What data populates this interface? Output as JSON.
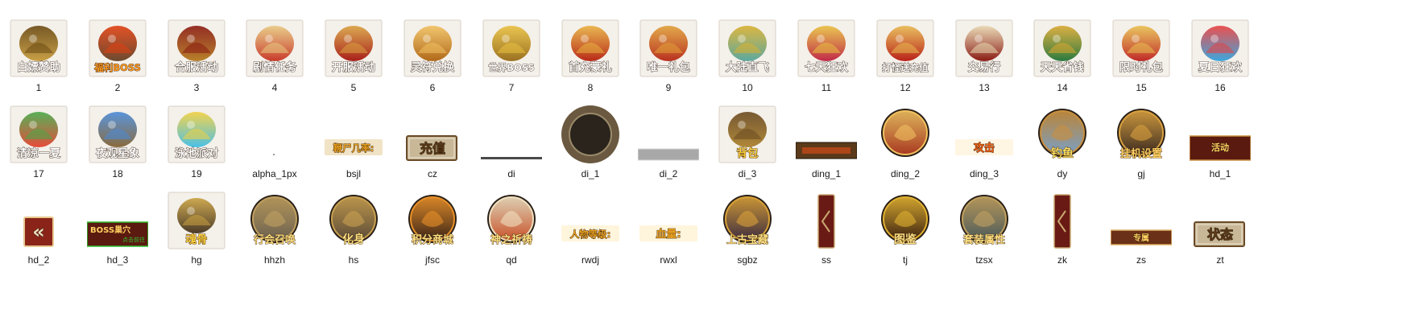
{
  "window": {
    "view": "large-icons"
  },
  "items": [
    {
      "name": "1",
      "caption": "白嫖赞助",
      "icon": "dragon-orb-icon",
      "style": "square",
      "color": "#c9a046",
      "accent": "#6b4a12"
    },
    {
      "name": "2",
      "caption": "福利BOSS",
      "icon": "winged-demon-icon",
      "style": "square",
      "color": "#6b4a30",
      "accent": "#e04010",
      "caption_color": "#ff9a20"
    },
    {
      "name": "3",
      "caption": "合服活动",
      "icon": "golden-dragon-chest-icon",
      "style": "square",
      "color": "#b8822a",
      "accent": "#8a1a10"
    },
    {
      "name": "4",
      "caption": "剧情任务",
      "icon": "scroll-icon",
      "style": "square",
      "color": "#c83a2a",
      "accent": "#e8c880"
    },
    {
      "name": "5",
      "caption": "开服活动",
      "icon": "red-gift-box-icon",
      "style": "square",
      "color": "#a81e1a",
      "accent": "#d8a040"
    },
    {
      "name": "6",
      "caption": "灵符兑换",
      "icon": "treasure-chest-icon",
      "style": "square",
      "color": "#b06818",
      "accent": "#f0c060"
    },
    {
      "name": "7",
      "caption": "世界BOSS",
      "icon": "dragon-head-icon",
      "style": "square",
      "color": "#9a7020",
      "accent": "#e8c040"
    },
    {
      "name": "8",
      "caption": "首充豪礼",
      "icon": "red-money-bag-icon",
      "style": "square",
      "color": "#b82818",
      "accent": "#e8b040"
    },
    {
      "name": "9",
      "caption": "唯一礼包",
      "icon": "red-money-bag-icon",
      "style": "square",
      "color": "#b83020",
      "accent": "#e0a038"
    },
    {
      "name": "10",
      "caption": "大陆直飞",
      "icon": "jade-ship-icon",
      "style": "square",
      "color": "#5aa8a0",
      "accent": "#d8b030"
    },
    {
      "name": "11",
      "caption": "七天狂欢",
      "icon": "heart-gift-icon",
      "style": "square",
      "color": "#c02848",
      "accent": "#e8c040"
    },
    {
      "name": "12",
      "caption": "打怪送充值",
      "icon": "red-envelope-icon",
      "style": "square",
      "color": "#b82018",
      "accent": "#e8b850"
    },
    {
      "name": "13",
      "caption": "交易行",
      "icon": "shop-sign-icon",
      "style": "square",
      "color": "#8a1a14",
      "accent": "#e8d8b0"
    },
    {
      "name": "14",
      "caption": "天天省钱",
      "icon": "green-chest-icon",
      "style": "square",
      "color": "#2a7a40",
      "accent": "#d8a830"
    },
    {
      "name": "15",
      "caption": "限时礼包",
      "icon": "red-gift-box-icon",
      "style": "square",
      "color": "#c02828",
      "accent": "#e8c050"
    },
    {
      "name": "16",
      "caption": "夏日狂欢",
      "icon": "beach-umbrella-icon",
      "style": "square",
      "color": "#3aa8e0",
      "accent": "#e84040"
    },
    {
      "name": "17",
      "caption": "清凉一夏",
      "icon": "fruit-drink-icon",
      "style": "square",
      "color": "#e84a3a",
      "accent": "#48a848"
    },
    {
      "name": "18",
      "caption": "夜观星象",
      "icon": "telescope-icon",
      "style": "square",
      "color": "#8a6a3a",
      "accent": "#4a8ad8"
    },
    {
      "name": "19",
      "caption": "泳池派对",
      "icon": "pool-float-icon",
      "style": "square",
      "color": "#48c0e8",
      "accent": "#f0d040"
    },
    {
      "name": "alpha_1px",
      "caption": "",
      "icon": "transparent-pixel-icon",
      "style": "dot",
      "color": "#9a9a9a",
      "accent": "#ffffff"
    },
    {
      "name": "bsjl",
      "caption": "鞭尸几率:",
      "icon": "text-label-icon",
      "style": "text",
      "color": "#f0e0c0",
      "accent": "#d89020",
      "caption_color": "#e8a020"
    },
    {
      "name": "cz",
      "caption": "充值",
      "icon": "recharge-button-icon",
      "style": "button",
      "color": "#c8b898",
      "accent": "#6a4a28",
      "caption_color": "#5a3a18"
    },
    {
      "name": "di",
      "caption": "",
      "icon": "thin-line-icon",
      "style": "line",
      "color": "#4a4a4a",
      "accent": "#8a8a8a"
    },
    {
      "name": "di_1",
      "caption": "",
      "icon": "ornate-frame-icon",
      "style": "frame",
      "color": "#6a5840",
      "accent": "#2a241c"
    },
    {
      "name": "di_2",
      "caption": "",
      "icon": "grey-bar-icon",
      "style": "bar",
      "color": "#a8a8a8",
      "accent": "#d8d8d8"
    },
    {
      "name": "di_3",
      "caption": "背包",
      "icon": "backpack-icon",
      "style": "square",
      "color": "#b08838",
      "accent": "#6a4a20",
      "caption_color": "#ffd040"
    },
    {
      "name": "ding_1",
      "caption": "",
      "icon": "top-bar-icon",
      "style": "band",
      "color": "#5a3a1a",
      "accent": "#c04818"
    },
    {
      "name": "ding_2",
      "caption": "",
      "icon": "hero-portrait-icon",
      "style": "circle",
      "color": "#a83820",
      "accent": "#f0c060"
    },
    {
      "name": "ding_3",
      "caption": "攻击",
      "icon": "attack-label-icon",
      "style": "text",
      "color": "#fff4e0",
      "accent": "#e85018",
      "caption_color": "#f06010"
    },
    {
      "name": "dy",
      "caption": "钓鱼",
      "icon": "fishing-icon",
      "style": "circle",
      "color": "#7aa0c8",
      "accent": "#c89040",
      "caption_color": "#ffe060"
    },
    {
      "name": "gj",
      "caption": "挂机设置",
      "icon": "gear-emblem-icon",
      "style": "circle",
      "color": "#3a2a20",
      "accent": "#d8a040",
      "caption_color": "#ffd060"
    },
    {
      "name": "hd_1",
      "caption": "活动",
      "icon": "event-banner-icon",
      "style": "banner",
      "color": "#5a1a10",
      "accent": "#c89040",
      "caption_color": "#ffd060"
    },
    {
      "name": "hd_2",
      "caption": "«",
      "icon": "chevron-left-icon",
      "style": "button",
      "color": "#8a2418",
      "accent": "#e8c890",
      "caption_color": "#f0e0c0"
    },
    {
      "name": "hd_3",
      "caption": "BOSS巢穴",
      "icon": "boss-lair-banner-icon",
      "style": "banner",
      "color": "#5a1a10",
      "accent": "#30c030",
      "caption_color": "#ffd060",
      "sub": "点击前往"
    },
    {
      "name": "hg",
      "caption": "魂骨",
      "icon": "skull-helmet-icon",
      "style": "square",
      "color": "#4a3a28",
      "accent": "#c8a040",
      "caption_color": "#ffd040"
    },
    {
      "name": "hhzh",
      "caption": "行会召唤",
      "icon": "guild-emblem-icon",
      "style": "circle",
      "color": "#6a6050",
      "accent": "#c0a060",
      "caption_color": "#ffe080"
    },
    {
      "name": "hs",
      "caption": "化身",
      "icon": "avatar-emblem-icon",
      "style": "circle",
      "color": "#5a4a38",
      "accent": "#c8a050",
      "caption_color": "#ffe080"
    },
    {
      "name": "jfsc",
      "caption": "积分商城",
      "icon": "points-shop-icon",
      "style": "circle",
      "color": "#3a2418",
      "accent": "#e89028",
      "caption_color": "#ffe080"
    },
    {
      "name": "qd",
      "caption": "神之祈祷",
      "icon": "prayer-icon",
      "style": "circle",
      "color": "#c85028",
      "accent": "#f0e0c0",
      "caption_color": "#ffe080"
    },
    {
      "name": "rwdj",
      "caption": "人物等级:",
      "icon": "text-label-icon",
      "style": "text",
      "color": "#fff4d8",
      "accent": "#d89020",
      "caption_color": "#e8a020"
    },
    {
      "name": "rwxl",
      "caption": "血量:",
      "icon": "text-label-icon",
      "style": "text",
      "color": "#fff4d8",
      "accent": "#d89020",
      "caption_color": "#e8a020"
    },
    {
      "name": "sgbz",
      "caption": "上古宝藏",
      "icon": "ancient-treasure-icon",
      "style": "circle",
      "color": "#3a2a40",
      "accent": "#d8a038",
      "caption_color": "#ffe080"
    },
    {
      "name": "ss",
      "caption": "",
      "icon": "vertical-tab-icon",
      "style": "vtab",
      "color": "#6a1a14",
      "accent": "#c8a870"
    },
    {
      "name": "tj",
      "caption": "图鉴",
      "icon": "scroll-book-icon",
      "style": "circle",
      "color": "#3a2010",
      "accent": "#e0b030",
      "caption_color": "#ffe080"
    },
    {
      "name": "tzsx",
      "caption": "套装属性",
      "icon": "armor-set-icon",
      "style": "circle",
      "color": "#4a5a5a",
      "accent": "#c0a060",
      "caption_color": "#ffe080"
    },
    {
      "name": "zk",
      "caption": "",
      "icon": "vertical-tab-icon",
      "style": "vtab",
      "color": "#6a1a14",
      "accent": "#c8a870"
    },
    {
      "name": "zs",
      "caption": "专属",
      "icon": "small-banner-icon",
      "style": "banner",
      "color": "#6a3018",
      "accent": "#e0b060",
      "caption_color": "#ffd060"
    },
    {
      "name": "zt",
      "caption": "状态",
      "icon": "status-button-icon",
      "style": "button",
      "color": "#c8b898",
      "accent": "#6a4a28",
      "caption_color": "#5a3a18"
    }
  ]
}
